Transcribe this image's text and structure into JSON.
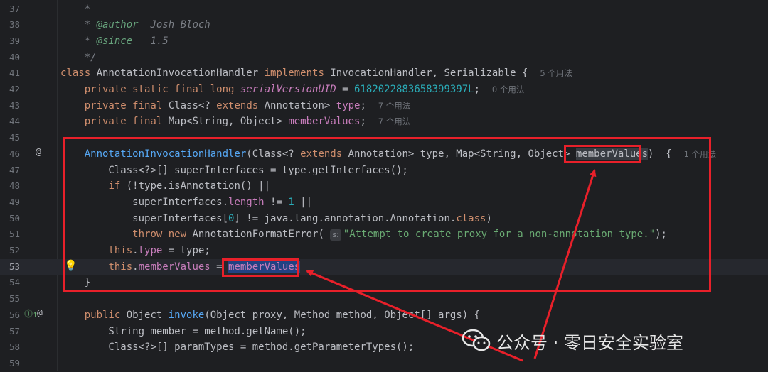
{
  "lines": [
    {
      "no": "37",
      "tokens": [
        [
          "cm",
          "    *"
        ]
      ]
    },
    {
      "no": "38",
      "tokens": [
        [
          "cm",
          "    * "
        ],
        [
          "tag",
          "@author"
        ],
        [
          "cm",
          "  Josh Bloch"
        ]
      ]
    },
    {
      "no": "39",
      "tokens": [
        [
          "cm",
          "    * "
        ],
        [
          "tag",
          "@since"
        ],
        [
          "cm",
          "   1.5"
        ]
      ]
    },
    {
      "no": "40",
      "tokens": [
        [
          "cm",
          "    */"
        ]
      ]
    },
    {
      "no": "41",
      "tokens": [
        [
          "kw",
          "class "
        ],
        [
          "",
          "AnnotationInvocationHandler "
        ],
        [
          "kw",
          "implements "
        ],
        [
          "",
          "InvocationHandler, Serializable {  "
        ],
        [
          "hint",
          "5 个用法"
        ]
      ]
    },
    {
      "no": "42",
      "tokens": [
        [
          "",
          "    "
        ],
        [
          "kw",
          "private static final long "
        ],
        [
          "sfld",
          "serialVersionUID"
        ],
        [
          "",
          " = "
        ],
        [
          "num",
          "6182022883658399397L"
        ],
        [
          "",
          ";  "
        ],
        [
          "hint",
          "0 个用法"
        ]
      ]
    },
    {
      "no": "43",
      "tokens": [
        [
          "",
          "    "
        ],
        [
          "kw",
          "private final "
        ],
        [
          "",
          "Class<? "
        ],
        [
          "kw",
          "extends "
        ],
        [
          "",
          "Annotation> "
        ],
        [
          "fld",
          "type"
        ],
        [
          "",
          ";  "
        ],
        [
          "hint",
          "7 个用法"
        ]
      ]
    },
    {
      "no": "44",
      "tokens": [
        [
          "",
          "    "
        ],
        [
          "kw",
          "private final "
        ],
        [
          "",
          "Map<String, Object> "
        ],
        [
          "fld",
          "memberValues"
        ],
        [
          "",
          ";  "
        ],
        [
          "hint",
          "7 个用法"
        ]
      ]
    },
    {
      "no": "45",
      "tokens": []
    },
    {
      "no": "46",
      "tokens": [
        [
          "",
          "    "
        ],
        [
          "fn",
          "AnnotationInvocationHandler"
        ],
        [
          "",
          "(Class<? "
        ],
        [
          "kw",
          "extends "
        ],
        [
          "",
          "Annotation> type, Map<String, Object> "
        ],
        [
          "occ",
          "memberValues"
        ],
        [
          "",
          ")  {  "
        ],
        [
          "hint",
          "1 个用法"
        ]
      ]
    },
    {
      "no": "47",
      "tokens": [
        [
          "",
          "        Class<?>[] superInterfaces = type.getInterfaces();"
        ]
      ]
    },
    {
      "no": "48",
      "tokens": [
        [
          "",
          "        "
        ],
        [
          "kw",
          "if "
        ],
        [
          "",
          "(!type.isAnnotation() ||"
        ]
      ]
    },
    {
      "no": "49",
      "tokens": [
        [
          "",
          "            superInterfaces."
        ],
        [
          "fld",
          "length"
        ],
        [
          "",
          " != "
        ],
        [
          "num",
          "1"
        ],
        [
          "",
          " ||"
        ]
      ]
    },
    {
      "no": "50",
      "tokens": [
        [
          "",
          "            superInterfaces["
        ],
        [
          "num",
          "0"
        ],
        [
          "",
          "] != java.lang.annotation.Annotation."
        ],
        [
          "kw",
          "class"
        ],
        [
          "",
          ")"
        ]
      ]
    },
    {
      "no": "51",
      "tokens": [
        [
          "",
          "            "
        ],
        [
          "kw",
          "throw new "
        ],
        [
          "",
          "AnnotationFormatError( "
        ],
        [
          "phint",
          "s:"
        ],
        [
          "str",
          "\"Attempt to create proxy for a non-annotation type.\""
        ],
        [
          "",
          ");"
        ]
      ]
    },
    {
      "no": "52",
      "tokens": [
        [
          "",
          "        "
        ],
        [
          "kw",
          "this"
        ],
        [
          "",
          "."
        ],
        [
          "fld",
          "type"
        ],
        [
          "",
          " = type;"
        ]
      ]
    },
    {
      "no": "53",
      "tokens": [
        [
          "",
          "        "
        ],
        [
          "kw",
          "this"
        ],
        [
          "",
          "."
        ],
        [
          "fld",
          "memberValues"
        ],
        [
          "",
          " = "
        ],
        [
          "selword",
          "memberValues"
        ]
      ]
    },
    {
      "no": "54",
      "tokens": [
        [
          "",
          "    }"
        ]
      ]
    },
    {
      "no": "55",
      "tokens": []
    },
    {
      "no": "56",
      "tokens": [
        [
          "",
          "    "
        ],
        [
          "kw",
          "public "
        ],
        [
          "",
          "Object "
        ],
        [
          "fn",
          "invoke"
        ],
        [
          "",
          "(Object proxy, Method method, Object[] args) {"
        ]
      ]
    },
    {
      "no": "57",
      "tokens": [
        [
          "",
          "        String member = method.getName();"
        ]
      ]
    },
    {
      "no": "58",
      "tokens": [
        [
          "",
          "        Class<?>[] paramTypes = method.getParameterTypes();"
        ]
      ]
    },
    {
      "no": "59",
      "tokens": []
    }
  ],
  "watermark": {
    "text": "公众号 · 零日安全实验室"
  },
  "colors": {
    "highlight_box": "#e8202a",
    "background": "#1e1f22"
  }
}
